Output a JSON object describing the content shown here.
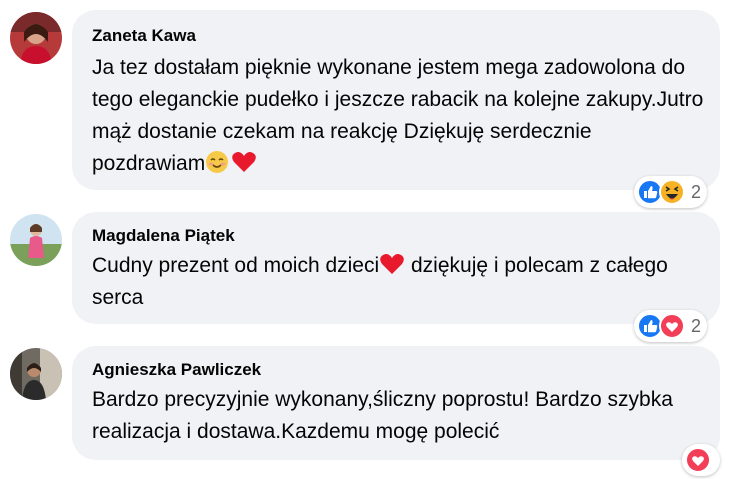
{
  "comments": [
    {
      "author": "Zaneta Kawa",
      "text": "Ja tez dostałam pięknie wykonane jestem mega zadowolona do tego eleganckie pudełko i jeszcze rabacik na kolejne zakupy.Jutro mąż dostanie czekam na reakcję Dziękuję serdecznie pozdrawiam",
      "reactions": [
        "like",
        "haha"
      ],
      "reaction_count": "2"
    },
    {
      "author": "Magdalena Piątek",
      "text_before": "Cudny prezent od moich dzieci",
      "text_after": " dziękuję i polecam z całego serca",
      "reactions": [
        "like",
        "love"
      ],
      "reaction_count": "2"
    },
    {
      "author": "Agnieszka Pawliczek",
      "text": "Bardzo precyzyjnie wykonany,śliczny poprostu! Bardzo szybka realizacja i dostawa.Kazdemu mogę polecić",
      "reactions": [
        "love"
      ],
      "reaction_count": ""
    }
  ]
}
